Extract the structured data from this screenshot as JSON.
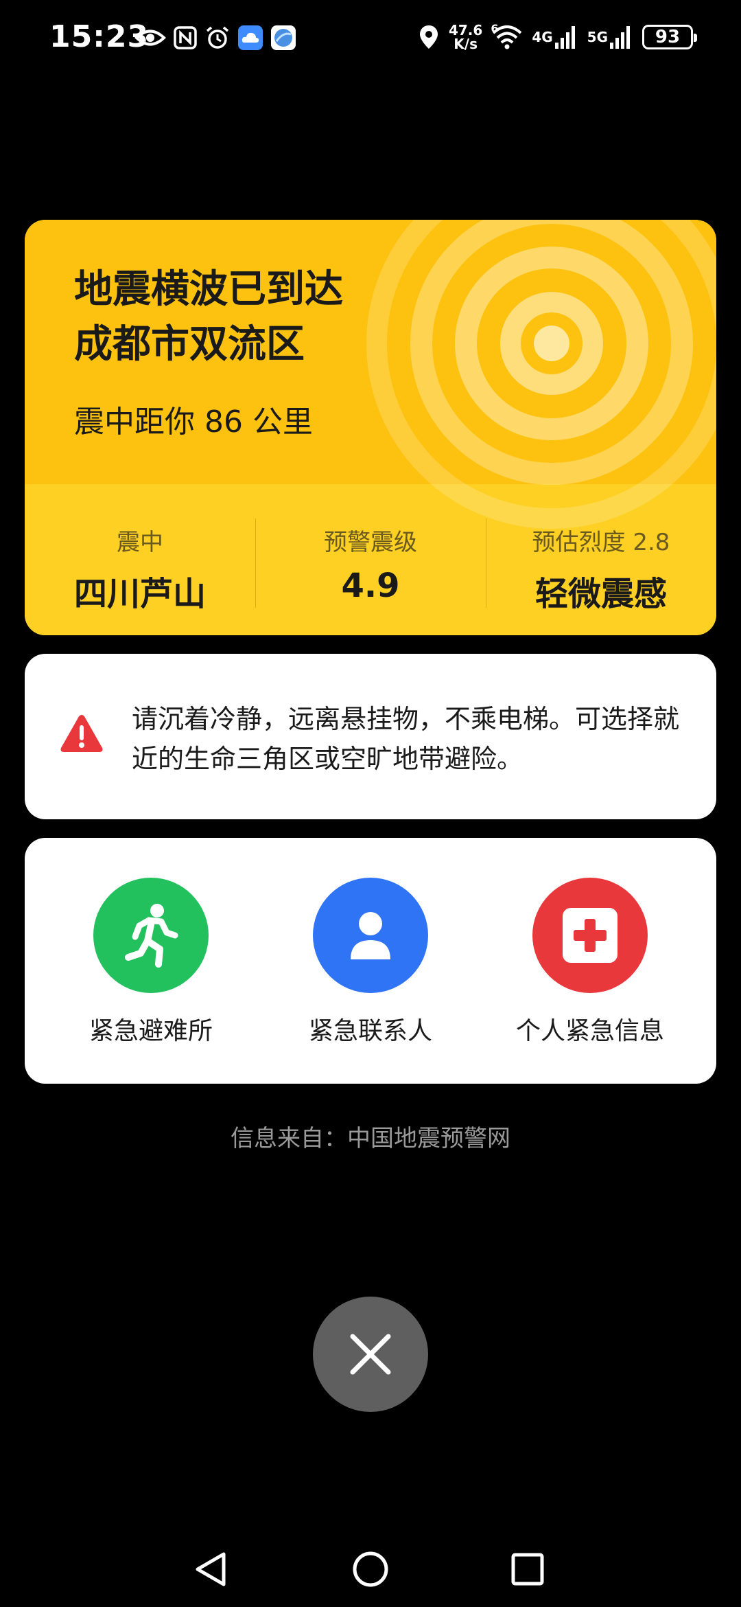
{
  "status_bar": {
    "time": "15:23",
    "net_speed_value": "47.6",
    "net_speed_unit": "K/s",
    "wifi_badge": "6",
    "signal1_label": "4G",
    "signal2_label": "5G",
    "battery": "93"
  },
  "alert": {
    "headline_line1": "地震横波已到达",
    "headline_line2": "成都市双流区",
    "distance": "震中距你 86 公里",
    "stats": [
      {
        "label": "震中",
        "value": "四川芦山"
      },
      {
        "label": "预警震级",
        "value": "4.9"
      },
      {
        "label": "预估烈度 2.8",
        "value": "轻微震感"
      }
    ],
    "colors": {
      "card": "#FDC20F",
      "card_bottom": "#FDD023"
    }
  },
  "tip": {
    "text": "请沉着冷静，远离悬挂物，不乘电梯。可选择就近的生命三角区或空旷地带避险。"
  },
  "actions": [
    {
      "label": "紧急避难所",
      "icon": "running-person-icon",
      "color": "#22C15E"
    },
    {
      "label": "紧急联系人",
      "icon": "contact-person-icon",
      "color": "#2F74F5"
    },
    {
      "label": "个人紧急信息",
      "icon": "medical-cross-icon",
      "color": "#E8383B"
    }
  ],
  "source": "信息来自：中国地震预警网"
}
